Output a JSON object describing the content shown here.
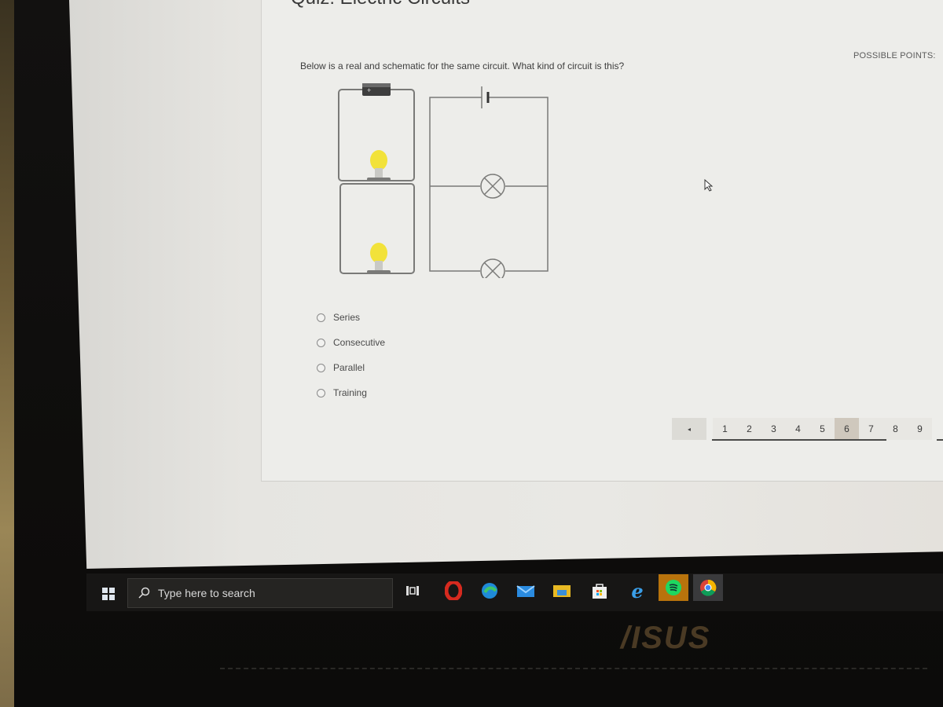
{
  "quiz": {
    "title": "Quiz: Electric Circuits",
    "possible_points_label": "POSSIBLE POINTS:",
    "question": "Below is a real and schematic for the same circuit. What kind of circuit is this?",
    "options": [
      {
        "label": "Series",
        "selected": false
      },
      {
        "label": "Consecutive",
        "selected": false
      },
      {
        "label": "Parallel",
        "selected": false
      },
      {
        "label": "Training",
        "selected": false
      }
    ]
  },
  "pagination": {
    "prev_icon": "◂",
    "pages": [
      "1",
      "2",
      "3",
      "4",
      "5",
      "6",
      "7",
      "8",
      "9"
    ],
    "current_page": "6"
  },
  "taskbar": {
    "search_placeholder": "Type here to search",
    "apps": [
      "task-view",
      "opera",
      "edge",
      "mail",
      "file-explorer",
      "microsoft-store",
      "internet-explorer",
      "spotify",
      "chrome"
    ]
  },
  "laptop_brand": "/ISUS",
  "colors": {
    "bulb_yellow": "#f2e23a",
    "spotify_highlight": "#b8730c",
    "taskbar_bg": "#171615",
    "panel_bg": "#ededea"
  }
}
